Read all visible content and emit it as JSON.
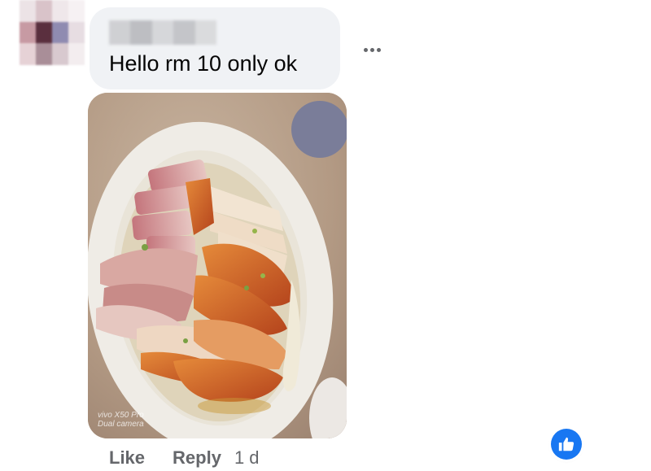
{
  "comment": {
    "text": "Hello rm 10 only ok",
    "photo_watermark": [
      "vivo X50 Pro",
      "Dual camera"
    ]
  },
  "actions": {
    "like_label": "Like",
    "reply_label": "Reply",
    "timestamp": "1 d"
  },
  "icons": {
    "more": "more-options-icon",
    "like_reaction": "thumbs-up-icon"
  },
  "colors": {
    "bubble_bg": "#f0f2f5",
    "secondary_text": "#65676b",
    "brand_blue": "#1877f2"
  }
}
